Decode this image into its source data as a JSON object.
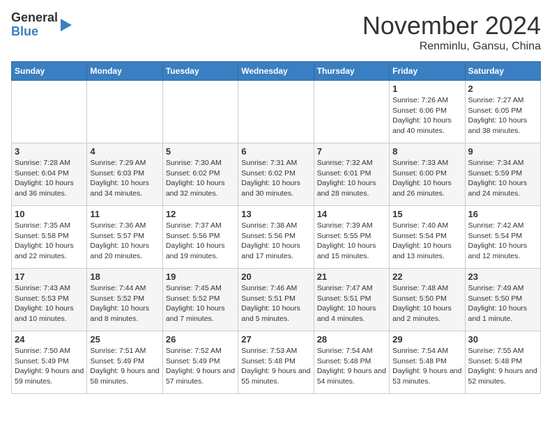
{
  "header": {
    "logo_line1": "General",
    "logo_line2": "Blue",
    "month": "November 2024",
    "location": "Renminlu, Gansu, China"
  },
  "weekdays": [
    "Sunday",
    "Monday",
    "Tuesday",
    "Wednesday",
    "Thursday",
    "Friday",
    "Saturday"
  ],
  "weeks": [
    [
      {
        "day": "",
        "info": ""
      },
      {
        "day": "",
        "info": ""
      },
      {
        "day": "",
        "info": ""
      },
      {
        "day": "",
        "info": ""
      },
      {
        "day": "",
        "info": ""
      },
      {
        "day": "1",
        "info": "Sunrise: 7:26 AM\nSunset: 6:06 PM\nDaylight: 10 hours and 40 minutes."
      },
      {
        "day": "2",
        "info": "Sunrise: 7:27 AM\nSunset: 6:05 PM\nDaylight: 10 hours and 38 minutes."
      }
    ],
    [
      {
        "day": "3",
        "info": "Sunrise: 7:28 AM\nSunset: 6:04 PM\nDaylight: 10 hours and 36 minutes."
      },
      {
        "day": "4",
        "info": "Sunrise: 7:29 AM\nSunset: 6:03 PM\nDaylight: 10 hours and 34 minutes."
      },
      {
        "day": "5",
        "info": "Sunrise: 7:30 AM\nSunset: 6:02 PM\nDaylight: 10 hours and 32 minutes."
      },
      {
        "day": "6",
        "info": "Sunrise: 7:31 AM\nSunset: 6:02 PM\nDaylight: 10 hours and 30 minutes."
      },
      {
        "day": "7",
        "info": "Sunrise: 7:32 AM\nSunset: 6:01 PM\nDaylight: 10 hours and 28 minutes."
      },
      {
        "day": "8",
        "info": "Sunrise: 7:33 AM\nSunset: 6:00 PM\nDaylight: 10 hours and 26 minutes."
      },
      {
        "day": "9",
        "info": "Sunrise: 7:34 AM\nSunset: 5:59 PM\nDaylight: 10 hours and 24 minutes."
      }
    ],
    [
      {
        "day": "10",
        "info": "Sunrise: 7:35 AM\nSunset: 5:58 PM\nDaylight: 10 hours and 22 minutes."
      },
      {
        "day": "11",
        "info": "Sunrise: 7:36 AM\nSunset: 5:57 PM\nDaylight: 10 hours and 20 minutes."
      },
      {
        "day": "12",
        "info": "Sunrise: 7:37 AM\nSunset: 5:56 PM\nDaylight: 10 hours and 19 minutes."
      },
      {
        "day": "13",
        "info": "Sunrise: 7:38 AM\nSunset: 5:56 PM\nDaylight: 10 hours and 17 minutes."
      },
      {
        "day": "14",
        "info": "Sunrise: 7:39 AM\nSunset: 5:55 PM\nDaylight: 10 hours and 15 minutes."
      },
      {
        "day": "15",
        "info": "Sunrise: 7:40 AM\nSunset: 5:54 PM\nDaylight: 10 hours and 13 minutes."
      },
      {
        "day": "16",
        "info": "Sunrise: 7:42 AM\nSunset: 5:54 PM\nDaylight: 10 hours and 12 minutes."
      }
    ],
    [
      {
        "day": "17",
        "info": "Sunrise: 7:43 AM\nSunset: 5:53 PM\nDaylight: 10 hours and 10 minutes."
      },
      {
        "day": "18",
        "info": "Sunrise: 7:44 AM\nSunset: 5:52 PM\nDaylight: 10 hours and 8 minutes."
      },
      {
        "day": "19",
        "info": "Sunrise: 7:45 AM\nSunset: 5:52 PM\nDaylight: 10 hours and 7 minutes."
      },
      {
        "day": "20",
        "info": "Sunrise: 7:46 AM\nSunset: 5:51 PM\nDaylight: 10 hours and 5 minutes."
      },
      {
        "day": "21",
        "info": "Sunrise: 7:47 AM\nSunset: 5:51 PM\nDaylight: 10 hours and 4 minutes."
      },
      {
        "day": "22",
        "info": "Sunrise: 7:48 AM\nSunset: 5:50 PM\nDaylight: 10 hours and 2 minutes."
      },
      {
        "day": "23",
        "info": "Sunrise: 7:49 AM\nSunset: 5:50 PM\nDaylight: 10 hours and 1 minute."
      }
    ],
    [
      {
        "day": "24",
        "info": "Sunrise: 7:50 AM\nSunset: 5:49 PM\nDaylight: 9 hours and 59 minutes."
      },
      {
        "day": "25",
        "info": "Sunrise: 7:51 AM\nSunset: 5:49 PM\nDaylight: 9 hours and 58 minutes."
      },
      {
        "day": "26",
        "info": "Sunrise: 7:52 AM\nSunset: 5:49 PM\nDaylight: 9 hours and 57 minutes."
      },
      {
        "day": "27",
        "info": "Sunrise: 7:53 AM\nSunset: 5:48 PM\nDaylight: 9 hours and 55 minutes."
      },
      {
        "day": "28",
        "info": "Sunrise: 7:54 AM\nSunset: 5:48 PM\nDaylight: 9 hours and 54 minutes."
      },
      {
        "day": "29",
        "info": "Sunrise: 7:54 AM\nSunset: 5:48 PM\nDaylight: 9 hours and 53 minutes."
      },
      {
        "day": "30",
        "info": "Sunrise: 7:55 AM\nSunset: 5:48 PM\nDaylight: 9 hours and 52 minutes."
      }
    ]
  ]
}
